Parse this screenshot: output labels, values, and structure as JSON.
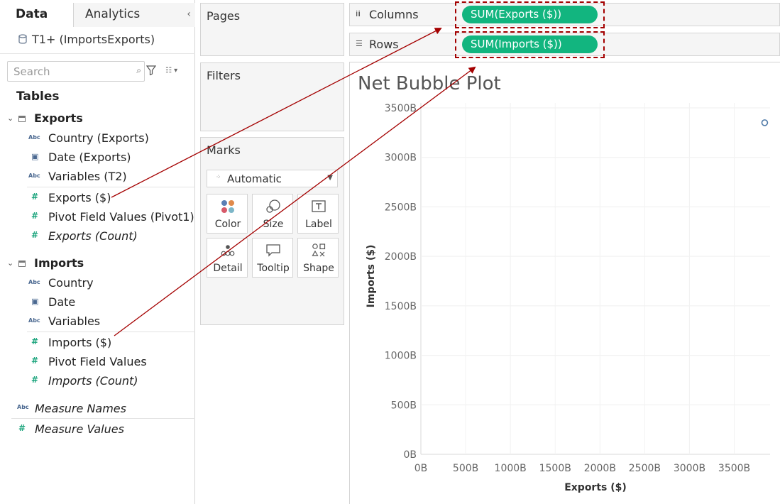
{
  "left_pane": {
    "tabs": [
      {
        "label": "Data"
      },
      {
        "label": "Analytics"
      }
    ],
    "collapse_glyph": "‹",
    "datasource": "T1+ (ImportsExports)",
    "search_placeholder": "Search",
    "tables_heading": "Tables",
    "groups": [
      {
        "label": "Exports",
        "fields": [
          {
            "type": "Abc",
            "label": "Country (Exports)"
          },
          {
            "type": "date",
            "label": "Date (Exports)"
          },
          {
            "type": "Abc",
            "label": "Variables (T2)"
          },
          {
            "type": "measure",
            "label": "Exports ($)"
          },
          {
            "type": "measure",
            "label": "Pivot Field Values (Pivot1)"
          },
          {
            "type": "measure",
            "label": "Exports (Count)"
          }
        ]
      },
      {
        "label": "Imports",
        "fields": [
          {
            "type": "Abc",
            "label": "Country"
          },
          {
            "type": "date",
            "label": "Date"
          },
          {
            "type": "Abc",
            "label": "Variables"
          },
          {
            "type": "measure",
            "label": "Imports ($)"
          },
          {
            "type": "measure",
            "label": "Pivot Field Values"
          },
          {
            "type": "measure",
            "label": "Imports (Count)"
          }
        ]
      }
    ],
    "measure_names": "Measure Names",
    "measure_values": "Measure Values",
    "abc_glyph": "Abc"
  },
  "cards": {
    "pages": "Pages",
    "filters": "Filters",
    "marks": "Marks",
    "marks_type": "Automatic",
    "mark_buttons": [
      {
        "label": "Color",
        "icon": "color-dots-icon"
      },
      {
        "label": "Size",
        "icon": "size-circles-icon"
      },
      {
        "label": "Label",
        "icon": "text-label-icon"
      },
      {
        "label": "Detail",
        "icon": "detail-dots-icon"
      },
      {
        "label": "Tooltip",
        "icon": "speech-bubble-icon"
      },
      {
        "label": "Shape",
        "icon": "shapes-icon"
      }
    ]
  },
  "shelves": {
    "columns_label": "Columns",
    "rows_label": "Rows",
    "columns_pill": "SUM(Exports ($))",
    "rows_pill": "SUM(Imports ($))",
    "pill_color": "#12b57f",
    "highlight_color": "#a40000"
  },
  "chart_data": {
    "type": "scatter",
    "title": "Net Bubble Plot",
    "xlabel": "Exports ($)",
    "ylabel": "Imports ($)",
    "x_ticks": [
      "0B",
      "500B",
      "1000B",
      "1500B",
      "2000B",
      "2500B",
      "3000B",
      "3500B"
    ],
    "y_ticks": [
      "0B",
      "500B",
      "1000B",
      "1500B",
      "2000B",
      "2500B",
      "3000B",
      "3500B"
    ],
    "xlim": [
      0,
      3900
    ],
    "ylim": [
      0,
      3550
    ],
    "grid": true,
    "points": [
      {
        "x": 3840,
        "y": 3350
      }
    ],
    "marker_color": "#4e79a7"
  }
}
